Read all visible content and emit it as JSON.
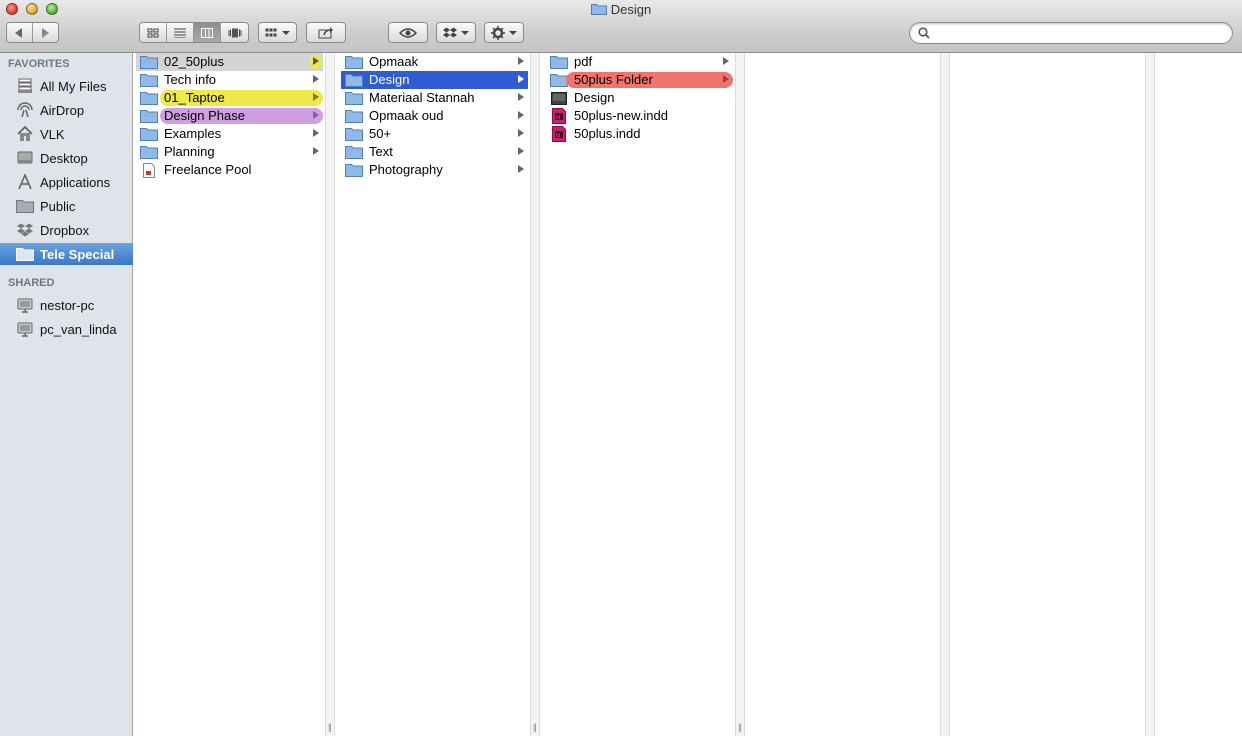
{
  "window": {
    "title": "Design"
  },
  "search": {
    "value": "",
    "placeholder": ""
  },
  "sidebar": {
    "favorites_header": "FAVORITES",
    "shared_header": "SHARED",
    "favorites": [
      {
        "label": "All My Files",
        "icon": "all-files-icon"
      },
      {
        "label": "AirDrop",
        "icon": "airdrop-icon"
      },
      {
        "label": "VLK",
        "icon": "home-icon"
      },
      {
        "label": "Desktop",
        "icon": "desktop-icon"
      },
      {
        "label": "Applications",
        "icon": "applications-icon"
      },
      {
        "label": "Public",
        "icon": "folder-icon"
      },
      {
        "label": "Dropbox",
        "icon": "dropbox-icon"
      },
      {
        "label": "Tele Special",
        "icon": "folder-icon",
        "selected": true
      }
    ],
    "shared": [
      {
        "label": "nestor-pc",
        "icon": "computer-icon"
      },
      {
        "label": "pc_van_linda",
        "icon": "computer-icon"
      }
    ]
  },
  "columns": [
    {
      "items": [
        {
          "name": "02_50plus",
          "type": "folder",
          "selected": "gray",
          "tag": "yellow-arrow"
        },
        {
          "name": "Tech info",
          "type": "folder"
        },
        {
          "name": "01_Taptoe",
          "type": "folder",
          "tag": "yellow"
        },
        {
          "name": "Design Phase",
          "type": "folder",
          "tag": "purple"
        },
        {
          "name": "Examples",
          "type": "folder"
        },
        {
          "name": "Planning",
          "type": "folder"
        },
        {
          "name": "Freelance Pool",
          "type": "file"
        }
      ]
    },
    {
      "items": [
        {
          "name": "Opmaak",
          "type": "folder"
        },
        {
          "name": "Design",
          "type": "folder",
          "selected": "blue"
        },
        {
          "name": "Materiaal Stannah",
          "type": "folder"
        },
        {
          "name": "Opmaak oud",
          "type": "folder"
        },
        {
          "name": "50+",
          "type": "folder"
        },
        {
          "name": "Text",
          "type": "folder"
        },
        {
          "name": "Photography",
          "type": "folder"
        }
      ]
    },
    {
      "items": [
        {
          "name": "pdf",
          "type": "folder"
        },
        {
          "name": "50plus Folder",
          "type": "folder",
          "tag": "red"
        },
        {
          "name": "Design",
          "type": "dark-file"
        },
        {
          "name": "50plus-new.indd",
          "type": "indd"
        },
        {
          "name": "50plus.indd",
          "type": "indd"
        }
      ]
    }
  ],
  "colors": {
    "selection_blue": "#2f5cd2",
    "sidebar_bg": "#dfe4ea",
    "tag_yellow": "#f0e84a",
    "tag_purple": "#cf9fe0",
    "tag_red": "#f0746c",
    "indesign_pink": "#d6186e"
  }
}
